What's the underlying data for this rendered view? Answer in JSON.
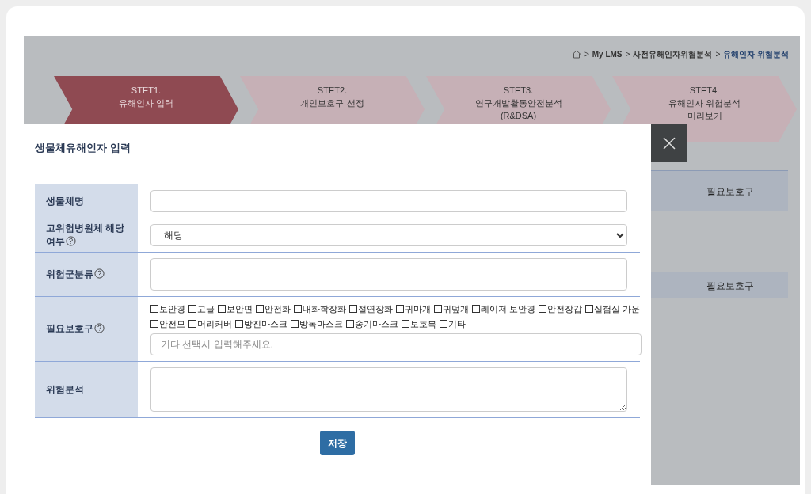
{
  "breadcrumb": {
    "separator": ">",
    "items": [
      "My LMS",
      "사전유해인자위험분석",
      "유해인자 위험분석"
    ]
  },
  "steps": [
    {
      "label": "STET1.",
      "lines": [
        "유해인자 입력"
      ],
      "selected": true
    },
    {
      "label": "STET2.",
      "lines": [
        "개인보호구 선정"
      ],
      "selected": false
    },
    {
      "label": "STET3.",
      "lines": [
        "연구개발활동안전분석",
        "(R&DSA)"
      ],
      "selected": false
    },
    {
      "label": "STET4.",
      "lines": [
        "유해인자 위험분석",
        "미리보기"
      ],
      "selected": false
    }
  ],
  "background_tables": [
    {
      "header": "필요보호구"
    },
    {
      "header": "필요보호구"
    }
  ],
  "modal": {
    "title": "생물체유해인자 입력",
    "fields": [
      {
        "kind": "text",
        "label": "생물체명",
        "help": false
      },
      {
        "kind": "select",
        "label": "고위험병원체 해당여부",
        "help": true,
        "value": "해당"
      },
      {
        "kind": "tall",
        "label": "위험군분류",
        "help": true
      },
      {
        "kind": "checkboxes",
        "label": "필요보호구",
        "help": true,
        "placeholder": "기타 선택시 입력해주세요.",
        "options": [
          {
            "label": "보안경",
            "checked": false
          },
          {
            "label": "고글",
            "checked": false
          },
          {
            "label": "보안면",
            "checked": false
          },
          {
            "label": "안전화",
            "checked": false
          },
          {
            "label": "내화학장화",
            "checked": false
          },
          {
            "label": "절연장화",
            "checked": false
          },
          {
            "label": "귀마개",
            "checked": false
          },
          {
            "label": "귀덮개",
            "checked": false
          },
          {
            "label": "레이저 보안경",
            "checked": false
          },
          {
            "label": "안전장갑",
            "checked": false
          },
          {
            "label": "실험실 가운",
            "checked": false
          },
          {
            "label": "안전모",
            "checked": false
          },
          {
            "label": "머리커버",
            "checked": false
          },
          {
            "label": "방진마스크",
            "checked": false
          },
          {
            "label": "방독마스크",
            "checked": false
          },
          {
            "label": "송기마스크",
            "checked": false
          },
          {
            "label": "보호복",
            "checked": false
          },
          {
            "label": "기타",
            "checked": false
          }
        ]
      },
      {
        "kind": "textarea",
        "label": "위험분석",
        "help": false
      }
    ],
    "save": "저장"
  }
}
